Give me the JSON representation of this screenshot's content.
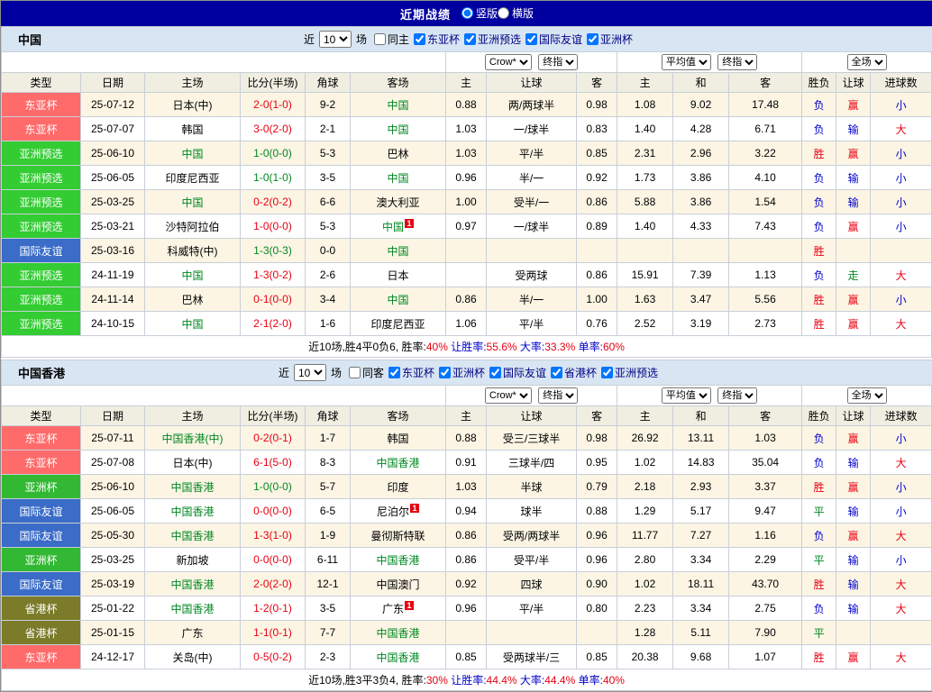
{
  "titlebar": {
    "title": "近期战绩",
    "layout_options": [
      {
        "label": "竖版",
        "checked": true
      },
      {
        "label": "横版",
        "checked": false
      }
    ]
  },
  "table_head": {
    "cols": [
      "类型",
      "日期",
      "主场",
      "比分(半场)",
      "角球",
      "客场"
    ],
    "selects": {
      "bookmaker": "Crow*",
      "bookmaker_stage": "终指",
      "europe": "平均值",
      "europe_stage": "终指",
      "scope": "全场"
    },
    "sub_cols": [
      "主",
      "让球",
      "客",
      "主",
      "和",
      "客",
      "胜负",
      "让球",
      "进球数"
    ]
  },
  "sections": [
    {
      "team": "中国",
      "filters": {
        "near": "近",
        "count": "10",
        "games": "场",
        "same": {
          "label": "同主",
          "checked": false
        },
        "leagues": [
          {
            "label": "东亚杯",
            "checked": true
          },
          {
            "label": "亚洲预选",
            "checked": true
          },
          {
            "label": "国际友谊",
            "checked": true
          },
          {
            "label": "亚洲杯",
            "checked": true
          }
        ]
      },
      "rows": [
        {
          "type": "东亚杯",
          "type_bg": "#ff6b6b",
          "date": "25-07-12",
          "home": "日本(中)",
          "score": "2-0(1-0)",
          "score_color": "#e60012",
          "corner": "9-2",
          "away": "中国",
          "away_color": "#008822",
          "h": "0.88",
          "hcap": "两/两球半",
          "a": "0.98",
          "e1": "1.08",
          "e2": "9.02",
          "e3": "17.48",
          "wdl": "负",
          "wdl_color": "#0000cc",
          "hres": "赢",
          "hres_color": "#e60012",
          "gres": "小",
          "gres_color": "#0000cc"
        },
        {
          "type": "东亚杯",
          "type_bg": "#ff6b6b",
          "date": "25-07-07",
          "home": "韩国",
          "score": "3-0(2-0)",
          "score_color": "#e60012",
          "corner": "2-1",
          "away": "中国",
          "away_color": "#008822",
          "h": "1.03",
          "hcap": "一/球半",
          "a": "0.83",
          "e1": "1.40",
          "e2": "4.28",
          "e3": "6.71",
          "wdl": "负",
          "wdl_color": "#0000cc",
          "hres": "输",
          "hres_color": "#0000cc",
          "gres": "大",
          "gres_color": "#e60012"
        },
        {
          "type": "亚洲预选",
          "type_bg": "#33cc33",
          "date": "25-06-10",
          "home": "中国",
          "home_color": "#008822",
          "score": "1-0(0-0)",
          "score_color": "#008822",
          "corner": "5-3",
          "away": "巴林",
          "h": "1.03",
          "hcap": "平/半",
          "a": "0.85",
          "e1": "2.31",
          "e2": "2.96",
          "e3": "3.22",
          "wdl": "胜",
          "wdl_color": "#e60012",
          "hres": "赢",
          "hres_color": "#e60012",
          "gres": "小",
          "gres_color": "#0000cc"
        },
        {
          "type": "亚洲预选",
          "type_bg": "#33cc33",
          "date": "25-06-05",
          "home": "印度尼西亚",
          "score": "1-0(1-0)",
          "score_color": "#008822",
          "corner": "3-5",
          "away": "中国",
          "away_color": "#008822",
          "h": "0.96",
          "hcap": "半/一",
          "a": "0.92",
          "e1": "1.73",
          "e2": "3.86",
          "e3": "4.10",
          "wdl": "负",
          "wdl_color": "#0000cc",
          "hres": "输",
          "hres_color": "#0000cc",
          "gres": "小",
          "gres_color": "#0000cc"
        },
        {
          "type": "亚洲预选",
          "type_bg": "#33cc33",
          "date": "25-03-25",
          "home": "中国",
          "home_color": "#008822",
          "score": "0-2(0-2)",
          "score_color": "#e60012",
          "corner": "6-6",
          "away": "澳大利亚",
          "h": "1.00",
          "hcap": "受半/一",
          "a": "0.86",
          "e1": "5.88",
          "e2": "3.86",
          "e3": "1.54",
          "wdl": "负",
          "wdl_color": "#0000cc",
          "hres": "输",
          "hres_color": "#0000cc",
          "gres": "小",
          "gres_color": "#0000cc"
        },
        {
          "type": "亚洲预选",
          "type_bg": "#33cc33",
          "date": "25-03-21",
          "home": "沙特阿拉伯",
          "score": "1-0(0-0)",
          "score_color": "#e60012",
          "corner": "5-3",
          "away": "中国",
          "away_color": "#008822",
          "away_card": "1",
          "h": "0.97",
          "hcap": "一/球半",
          "a": "0.89",
          "e1": "1.40",
          "e2": "4.33",
          "e3": "7.43",
          "wdl": "负",
          "wdl_color": "#0000cc",
          "hres": "赢",
          "hres_color": "#e60012",
          "gres": "小",
          "gres_color": "#0000cc"
        },
        {
          "type": "国际友谊",
          "type_bg": "#3a6cc8",
          "date": "25-03-16",
          "home": "科威特(中)",
          "score": "1-3(0-3)",
          "score_color": "#008822",
          "corner": "0-0",
          "away": "中国",
          "away_color": "#008822",
          "h": "",
          "hcap": "",
          "a": "",
          "e1": "",
          "e2": "",
          "e3": "",
          "wdl": "胜",
          "wdl_color": "#e60012",
          "hres": "",
          "gres": ""
        },
        {
          "type": "亚洲预选",
          "type_bg": "#33cc33",
          "date": "24-11-19",
          "home": "中国",
          "home_color": "#008822",
          "score": "1-3(0-2)",
          "score_color": "#e60012",
          "corner": "2-6",
          "away": "日本",
          "h": "",
          "hcap": "受两球",
          "a": "0.86",
          "e1": "15.91",
          "e2": "7.39",
          "e3": "1.13",
          "wdl": "负",
          "wdl_color": "#0000cc",
          "hres": "走",
          "hres_color": "#008822",
          "gres": "大",
          "gres_color": "#e60012"
        },
        {
          "type": "亚洲预选",
          "type_bg": "#33cc33",
          "date": "24-11-14",
          "home": "巴林",
          "score": "0-1(0-0)",
          "score_color": "#e60012",
          "corner": "3-4",
          "away": "中国",
          "away_color": "#008822",
          "h": "0.86",
          "hcap": "半/一",
          "a": "1.00",
          "e1": "1.63",
          "e2": "3.47",
          "e3": "5.56",
          "wdl": "胜",
          "wdl_color": "#e60012",
          "hres": "赢",
          "hres_color": "#e60012",
          "gres": "小",
          "gres_color": "#0000cc"
        },
        {
          "type": "亚洲预选",
          "type_bg": "#33cc33",
          "date": "24-10-15",
          "home": "中国",
          "home_color": "#008822",
          "score": "2-1(2-0)",
          "score_color": "#e60012",
          "corner": "1-6",
          "away": "印度尼西亚",
          "h": "1.06",
          "hcap": "平/半",
          "a": "0.76",
          "e1": "2.52",
          "e2": "3.19",
          "e3": "2.73",
          "wdl": "胜",
          "wdl_color": "#e60012",
          "hres": "赢",
          "hres_color": "#e60012",
          "gres": "大",
          "gres_color": "#e60012"
        }
      ],
      "footer_segments": [
        {
          "text": "近10场,胜4平0负6, ",
          "color": "#000000"
        },
        {
          "text": "胜率:",
          "color": "#000000"
        },
        {
          "text": "40%",
          "color": "#e60012"
        },
        {
          "text": " 让胜率:",
          "color": "#0000cc"
        },
        {
          "text": "55.6%",
          "color": "#e60012"
        },
        {
          "text": " 大率:",
          "color": "#0000cc"
        },
        {
          "text": "33.3%",
          "color": "#e60012"
        },
        {
          "text": " 单率:",
          "color": "#0000cc"
        },
        {
          "text": "60%",
          "color": "#e60012"
        }
      ]
    },
    {
      "team": "中国香港",
      "filters": {
        "near": "近",
        "count": "10",
        "games": "场",
        "same": {
          "label": "同客",
          "checked": false
        },
        "leagues": [
          {
            "label": "东亚杯",
            "checked": true
          },
          {
            "label": "亚洲杯",
            "checked": true
          },
          {
            "label": "国际友谊",
            "checked": true
          },
          {
            "label": "省港杯",
            "checked": true
          },
          {
            "label": "亚洲预选",
            "checked": true
          }
        ]
      },
      "rows": [
        {
          "type": "东亚杯",
          "type_bg": "#ff6b6b",
          "date": "25-07-11",
          "home": "中国香港(中)",
          "home_color": "#008822",
          "score": "0-2(0-1)",
          "score_color": "#e60012",
          "corner": "1-7",
          "away": "韩国",
          "h": "0.88",
          "hcap": "受三/三球半",
          "a": "0.98",
          "e1": "26.92",
          "e2": "13.11",
          "e3": "1.03",
          "wdl": "负",
          "wdl_color": "#0000cc",
          "hres": "赢",
          "hres_color": "#e60012",
          "gres": "小",
          "gres_color": "#0000cc"
        },
        {
          "type": "东亚杯",
          "type_bg": "#ff6b6b",
          "date": "25-07-08",
          "home": "日本(中)",
          "score": "6-1(5-0)",
          "score_color": "#e60012",
          "corner": "8-3",
          "away": "中国香港",
          "away_color": "#008822",
          "h": "0.91",
          "hcap": "三球半/四",
          "a": "0.95",
          "e1": "1.02",
          "e2": "14.83",
          "e3": "35.04",
          "wdl": "负",
          "wdl_color": "#0000cc",
          "hres": "输",
          "hres_color": "#0000cc",
          "gres": "大",
          "gres_color": "#e60012"
        },
        {
          "type": "亚洲杯",
          "type_bg": "#33b833",
          "date": "25-06-10",
          "home": "中国香港",
          "home_color": "#008822",
          "score": "1-0(0-0)",
          "score_color": "#008822",
          "corner": "5-7",
          "away": "印度",
          "h": "1.03",
          "hcap": "半球",
          "a": "0.79",
          "e1": "2.18",
          "e2": "2.93",
          "e3": "3.37",
          "wdl": "胜",
          "wdl_color": "#e60012",
          "hres": "赢",
          "hres_color": "#e60012",
          "gres": "小",
          "gres_color": "#0000cc"
        },
        {
          "type": "国际友谊",
          "type_bg": "#3a6cc8",
          "date": "25-06-05",
          "home": "中国香港",
          "home_color": "#008822",
          "score": "0-0(0-0)",
          "score_color": "#e60012",
          "corner": "6-5",
          "away": "尼泊尔",
          "away_card": "1",
          "h": "0.94",
          "hcap": "球半",
          "a": "0.88",
          "e1": "1.29",
          "e2": "5.17",
          "e3": "9.47",
          "wdl": "平",
          "wdl_color": "#008822",
          "hres": "输",
          "hres_color": "#0000cc",
          "gres": "小",
          "gres_color": "#0000cc"
        },
        {
          "type": "国际友谊",
          "type_bg": "#3a6cc8",
          "date": "25-05-30",
          "home": "中国香港",
          "home_color": "#008822",
          "score": "1-3(1-0)",
          "score_color": "#e60012",
          "corner": "1-9",
          "away": "曼彻斯特联",
          "h": "0.86",
          "hcap": "受两/两球半",
          "a": "0.96",
          "e1": "11.77",
          "e2": "7.27",
          "e3": "1.16",
          "wdl": "负",
          "wdl_color": "#0000cc",
          "hres": "赢",
          "hres_color": "#e60012",
          "gres": "大",
          "gres_color": "#e60012"
        },
        {
          "type": "亚洲杯",
          "type_bg": "#33b833",
          "date": "25-03-25",
          "home": "新加坡",
          "score": "0-0(0-0)",
          "score_color": "#e60012",
          "corner": "6-11",
          "away": "中国香港",
          "away_color": "#008822",
          "h": "0.86",
          "hcap": "受平/半",
          "a": "0.96",
          "e1": "2.80",
          "e2": "3.34",
          "e3": "2.29",
          "wdl": "平",
          "wdl_color": "#008822",
          "hres": "输",
          "hres_color": "#0000cc",
          "gres": "小",
          "gres_color": "#0000cc"
        },
        {
          "type": "国际友谊",
          "type_bg": "#3a6cc8",
          "date": "25-03-19",
          "home": "中国香港",
          "home_color": "#008822",
          "score": "2-0(2-0)",
          "score_color": "#e60012",
          "corner": "12-1",
          "away": "中国澳门",
          "h": "0.92",
          "hcap": "四球",
          "a": "0.90",
          "e1": "1.02",
          "e2": "18.11",
          "e3": "43.70",
          "wdl": "胜",
          "wdl_color": "#e60012",
          "hres": "输",
          "hres_color": "#0000cc",
          "gres": "大",
          "gres_color": "#e60012"
        },
        {
          "type": "省港杯",
          "type_bg": "#7b7b2a",
          "date": "25-01-22",
          "home": "中国香港",
          "home_color": "#008822",
          "score": "1-2(0-1)",
          "score_color": "#e60012",
          "corner": "3-5",
          "away": "广东",
          "away_card": "1",
          "h": "0.96",
          "hcap": "平/半",
          "a": "0.80",
          "e1": "2.23",
          "e2": "3.34",
          "e3": "2.75",
          "wdl": "负",
          "wdl_color": "#0000cc",
          "hres": "输",
          "hres_color": "#0000cc",
          "gres": "大",
          "gres_color": "#e60012"
        },
        {
          "type": "省港杯",
          "type_bg": "#7b7b2a",
          "date": "25-01-15",
          "home": "广东",
          "score": "1-1(0-1)",
          "score_color": "#e60012",
          "corner": "7-7",
          "away": "中国香港",
          "away_color": "#008822",
          "h": "",
          "hcap": "",
          "a": "",
          "e1": "1.28",
          "e2": "5.11",
          "e3": "7.90",
          "wdl": "平",
          "wdl_color": "#008822",
          "hres": "",
          "gres": ""
        },
        {
          "type": "东亚杯",
          "type_bg": "#ff6b6b",
          "date": "24-12-17",
          "home": "关岛(中)",
          "score": "0-5(0-2)",
          "score_color": "#e60012",
          "corner": "2-3",
          "away": "中国香港",
          "away_color": "#008822",
          "h": "0.85",
          "hcap": "受两球半/三",
          "a": "0.85",
          "e1": "20.38",
          "e2": "9.68",
          "e3": "1.07",
          "wdl": "胜",
          "wdl_color": "#e60012",
          "hres": "赢",
          "hres_color": "#e60012",
          "gres": "大",
          "gres_color": "#e60012"
        }
      ],
      "footer_segments": [
        {
          "text": "近10场,胜3平3负4, ",
          "color": "#000000"
        },
        {
          "text": "胜率:",
          "color": "#000000"
        },
        {
          "text": "30%",
          "color": "#e60012"
        },
        {
          "text": " 让胜率:",
          "color": "#0000cc"
        },
        {
          "text": "44.4%",
          "color": "#e60012"
        },
        {
          "text": " 大率:",
          "color": "#0000cc"
        },
        {
          "text": "44.4%",
          "color": "#e60012"
        },
        {
          "text": " 单率:",
          "color": "#0000cc"
        },
        {
          "text": "40%",
          "color": "#e60012"
        }
      ]
    }
  ]
}
